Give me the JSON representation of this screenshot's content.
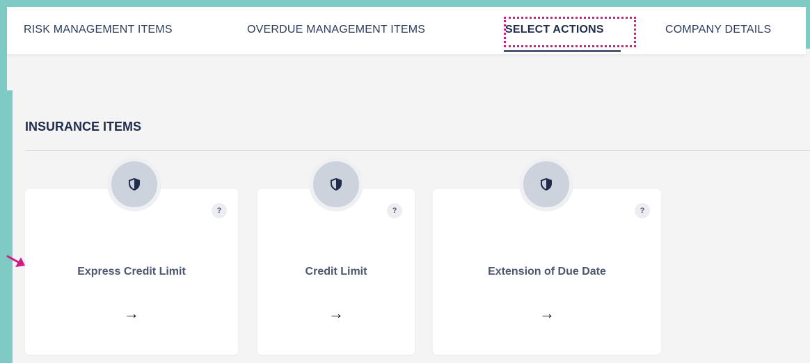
{
  "tabs": [
    {
      "label": "RISK MANAGEMENT ITEMS",
      "active": false
    },
    {
      "label": "OVERDUE MANAGEMENT ITEMS",
      "active": false
    },
    {
      "label": "SELECT ACTIONS",
      "active": true
    },
    {
      "label": "COMPANY DETAILS",
      "active": false
    }
  ],
  "section": {
    "title": "INSURANCE ITEMS"
  },
  "cards": [
    {
      "label": "Express Credit Limit",
      "help": "?",
      "arrow": "→",
      "icon": "shield-icon"
    },
    {
      "label": "Credit Limit",
      "help": "?",
      "arrow": "→",
      "icon": "shield-icon"
    },
    {
      "label": "Extension of Due Date",
      "help": "?",
      "arrow": "→",
      "icon": "shield-icon"
    }
  ],
  "colors": {
    "accent_teal": "#7fcac5",
    "highlight_magenta": "#d01a86",
    "navy_text": "#1f2c4a"
  }
}
